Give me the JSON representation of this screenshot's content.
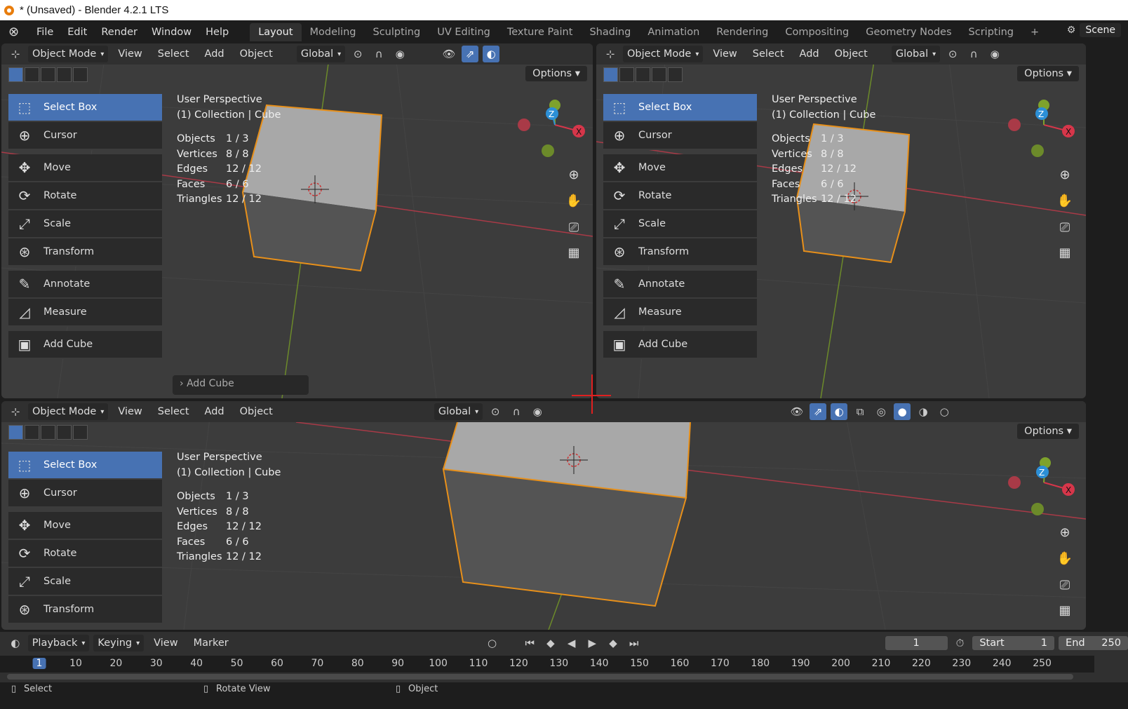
{
  "window": {
    "title": "* (Unsaved) - Blender 4.2.1 LTS"
  },
  "menu": [
    "File",
    "Edit",
    "Render",
    "Window",
    "Help"
  ],
  "workspaces": [
    "Layout",
    "Modeling",
    "Sculpting",
    "UV Editing",
    "Texture Paint",
    "Shading",
    "Animation",
    "Rendering",
    "Compositing",
    "Geometry Nodes",
    "Scripting"
  ],
  "scene": "Scene",
  "header": {
    "mode": "Object Mode",
    "view": "View",
    "select": "Select",
    "add": "Add",
    "object": "Object",
    "orientation": "Global",
    "options": "Options"
  },
  "tools": [
    "Select Box",
    "Cursor",
    "Move",
    "Rotate",
    "Scale",
    "Transform",
    "Annotate",
    "Measure",
    "Add Cube"
  ],
  "overlay": {
    "perspective": "User Perspective",
    "collection": "(1) Collection | Cube"
  },
  "stats": [
    {
      "label": "Objects",
      "value": "1 / 3"
    },
    {
      "label": "Vertices",
      "value": "8 / 8"
    },
    {
      "label": "Edges",
      "value": "12 / 12"
    },
    {
      "label": "Faces",
      "value": "6 / 6"
    },
    {
      "label": "Triangles",
      "value": "12 / 12"
    }
  ],
  "last_op": "Add Cube",
  "timeline": {
    "menus": [
      "Playback",
      "Keying",
      "View",
      "Marker"
    ],
    "current": "1",
    "start_label": "Start",
    "start": "1",
    "end_label": "End",
    "end": "250",
    "ticks": [
      "1",
      "10",
      "20",
      "30",
      "40",
      "50",
      "60",
      "70",
      "80",
      "90",
      "100",
      "110",
      "120",
      "130",
      "140",
      "150",
      "160",
      "170",
      "180",
      "190",
      "200",
      "210",
      "220",
      "230",
      "240",
      "250"
    ]
  },
  "status": {
    "select": "Select",
    "rotate": "Rotate View",
    "object": "Object"
  },
  "colors": {
    "accent": "#4772b3",
    "selection": "#e8901a",
    "axis_x": "#d6364a",
    "axis_y": "#7ea22c",
    "axis_z": "#2c8fd6"
  }
}
